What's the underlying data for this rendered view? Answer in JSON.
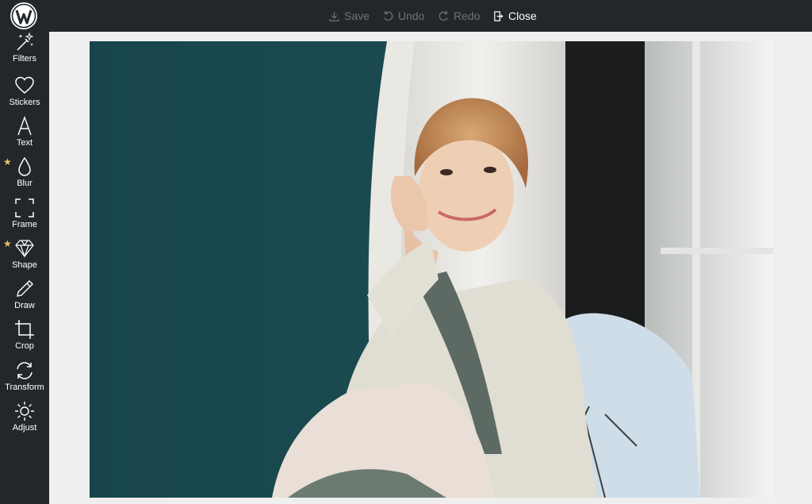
{
  "toolbar": {
    "save_label": "Save",
    "undo_label": "Undo",
    "redo_label": "Redo",
    "close_label": "Close"
  },
  "sidebar": {
    "items": [
      {
        "label": "Filters",
        "icon": "magic-wand-icon",
        "starred": false
      },
      {
        "label": "Stickers",
        "icon": "heart-icon",
        "starred": false
      },
      {
        "label": "Text",
        "icon": "text-icon",
        "starred": false
      },
      {
        "label": "Blur",
        "icon": "droplet-icon",
        "starred": true
      },
      {
        "label": "Frame",
        "icon": "frame-icon",
        "starred": false
      },
      {
        "label": "Shape",
        "icon": "diamond-icon",
        "starred": true
      },
      {
        "label": "Draw",
        "icon": "pencil-icon",
        "starred": false
      },
      {
        "label": "Crop",
        "icon": "crop-icon",
        "starred": false
      },
      {
        "label": "Transform",
        "icon": "rotate-icon",
        "starred": false
      },
      {
        "label": "Adjust",
        "icon": "sun-icon",
        "starred": false
      }
    ]
  },
  "colors": {
    "chrome": "#23272b",
    "canvas_bg": "#efefef",
    "accent_star": "#e8c46a",
    "disabled_text": "#6f7378"
  }
}
